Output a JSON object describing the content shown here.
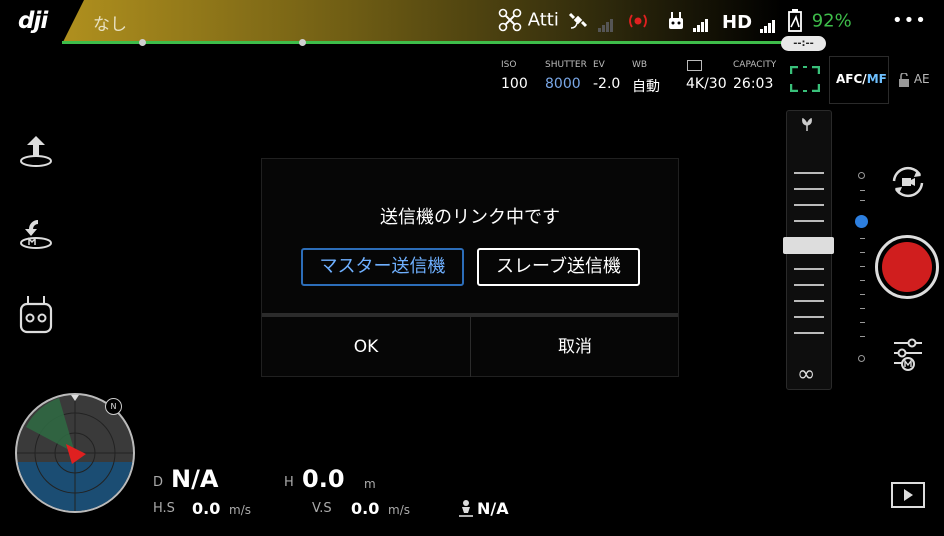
{
  "app": {
    "logo": "dji"
  },
  "status": {
    "flight_status": "なし",
    "mode": "Atti",
    "battery_percent": "92%",
    "hd_label": "HD",
    "time_remaining": "--:--",
    "more": "•••"
  },
  "camera": {
    "iso_label": "ISO",
    "iso": "100",
    "shutter_label": "SHUTTER",
    "shutter": "8000",
    "ev_label": "EV",
    "ev": "-2.0",
    "wb_label": "WB",
    "wb": "自動",
    "resolution": "4K/30",
    "capacity_label": "CAPACITY",
    "capacity": "26:03",
    "afc": "AFC/",
    "mf": "MF",
    "ae": "AE"
  },
  "focus": {
    "infinity": "∞"
  },
  "dialog": {
    "message": "送信機のリンク中です",
    "master_button": "マスター送信機",
    "slave_button": "スレーブ送信機",
    "ok_button": "OK",
    "cancel_button": "取消"
  },
  "telemetry": {
    "d_label": "D",
    "d_value": "N/A",
    "h_label": "H",
    "h_value": "0.0",
    "h_unit": "m",
    "hs_label": "H.S",
    "hs_value": "0.0",
    "hs_unit": "m/s",
    "vs_label": "V.S",
    "vs_value": "0.0",
    "vs_unit": "m/s",
    "home_value": "N/A"
  },
  "radar": {
    "north": "N"
  },
  "colors": {
    "accent_blue": "#2c6db8",
    "record_red": "#d01e1e",
    "battery_green": "#3ebd4a",
    "status_gold": "#b0901e"
  }
}
